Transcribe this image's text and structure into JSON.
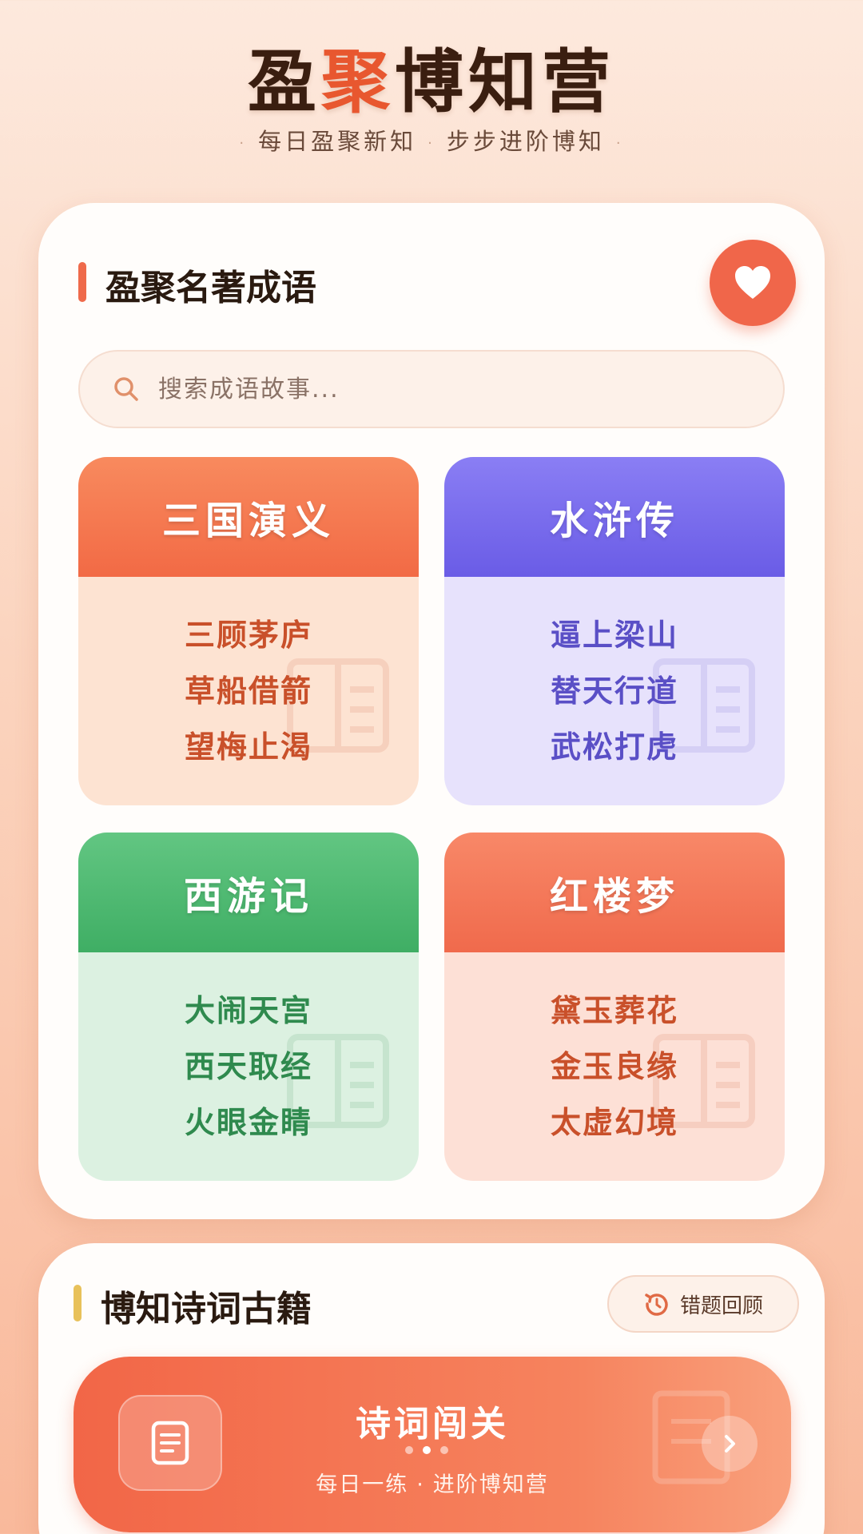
{
  "header": {
    "title_part1": "盈",
    "title_accent": "聚",
    "title_part2": "博知营",
    "subtitle_left": "每日盈聚新知",
    "subtitle_right": "步步进阶博知",
    "dot": "·"
  },
  "idioms_section": {
    "title": "盈聚名著成语",
    "bar_color": "#ef6a4b",
    "favorite_icon": "heart-icon",
    "search": {
      "placeholder": "搜索成语故事...",
      "icon": "search-icon"
    },
    "books": [
      {
        "name": "三国演义",
        "head_color": "#f47a4f",
        "body_color": "#fde3d2",
        "text_color": "#c9502a",
        "idioms": [
          "三顾茅庐",
          "草船借箭",
          "望梅止渴"
        ]
      },
      {
        "name": "水浒传",
        "head_color": "#7a6cf0",
        "body_color": "#e7e2fc",
        "text_color": "#5a4fc6",
        "idioms": [
          "逼上梁山",
          "替天行道",
          "武松打虎"
        ]
      },
      {
        "name": "西游记",
        "head_color": "#4fba72",
        "body_color": "#dcf1e1",
        "text_color": "#2f8a4e",
        "idioms": [
          "大闹天宫",
          "西天取经",
          "火眼金睛"
        ]
      },
      {
        "name": "红楼梦",
        "head_color": "#f4785a",
        "body_color": "#fde0d6",
        "text_color": "#c9502a",
        "idioms": [
          "黛玉葬花",
          "金玉良缘",
          "太虚幻境"
        ]
      }
    ]
  },
  "poetry_section": {
    "title": "博知诗词古籍",
    "bar_color": "#e8c15a",
    "review_button": {
      "label": "错题回顾",
      "icon": "history-icon"
    },
    "challenge": {
      "title": "诗词闯关",
      "subtitle_left": "每日一练",
      "subtitle_sep": "·",
      "subtitle_right": "进阶博知营",
      "icon": "document-icon",
      "arrow_icon": "chevron-right-icon"
    }
  }
}
